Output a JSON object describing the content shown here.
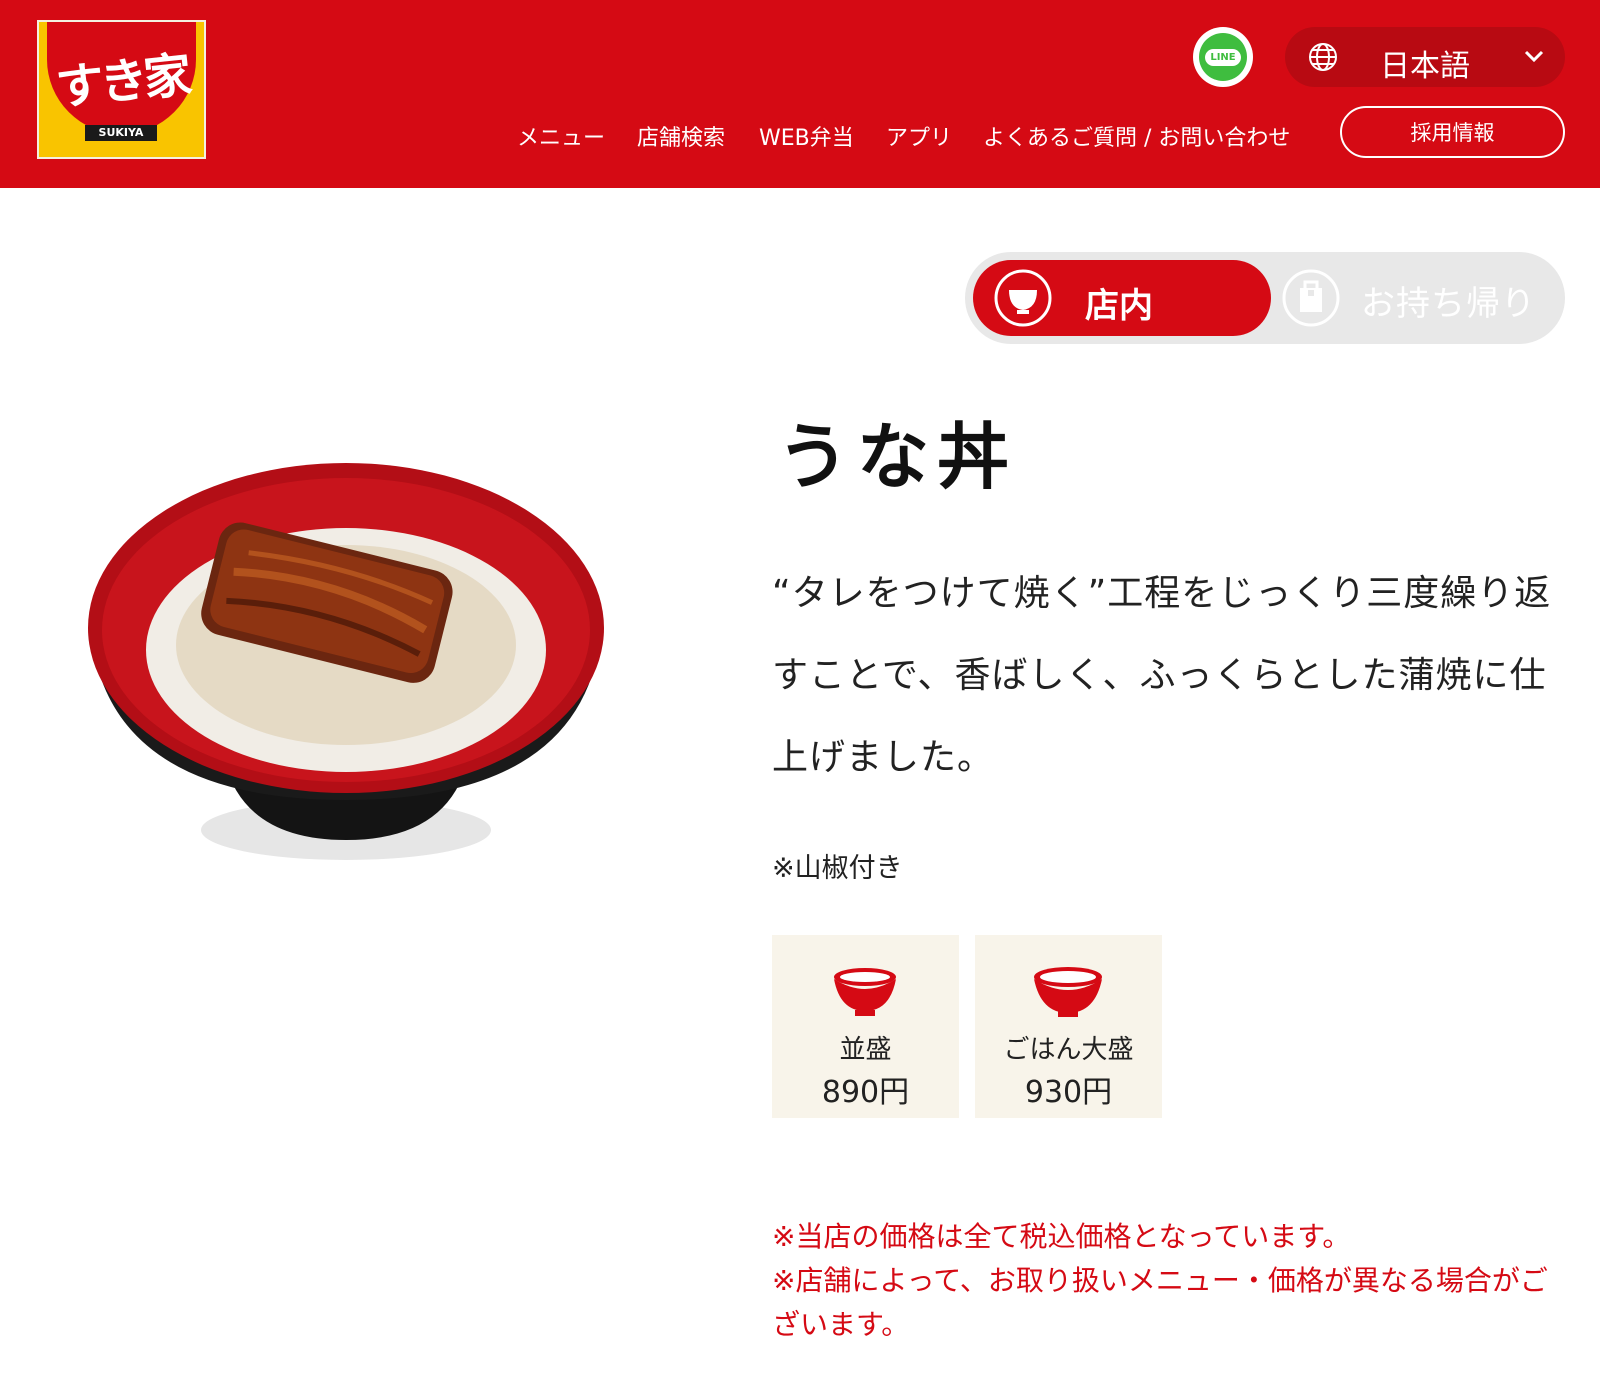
{
  "header": {
    "logo_text": "すき家",
    "logo_sub": "SUKIYA",
    "line_label": "LINE",
    "language": "日本語",
    "nav": [
      "メニュー",
      "店舗検索",
      "WEB弁当",
      "アプリ",
      "よくあるご質問 / お問い合わせ"
    ],
    "recruit": "採用情報"
  },
  "toggle": {
    "eat_in": "店内",
    "take_out": "お持ち帰り"
  },
  "product": {
    "title": "うな丼",
    "description": "“タレをつけて焼く”工程をじっくり三度繰り返すことで、香ばしく、ふっくらとした蒲焼に仕上げました。",
    "note": "※山椒付き",
    "sizes": [
      {
        "name": "並盛",
        "price": "890円"
      },
      {
        "name": "ごはん大盛",
        "price": "930円"
      }
    ]
  },
  "disclaimers": [
    "※当店の価格は全て税込価格となっています。",
    "※店舗によって、お取り扱いメニュー・価格が異なる場合がございます。"
  ],
  "colors": {
    "brand_red": "#d50a14",
    "card_bg": "#f8f4ea",
    "toggle_bg": "#e8e8e8"
  }
}
